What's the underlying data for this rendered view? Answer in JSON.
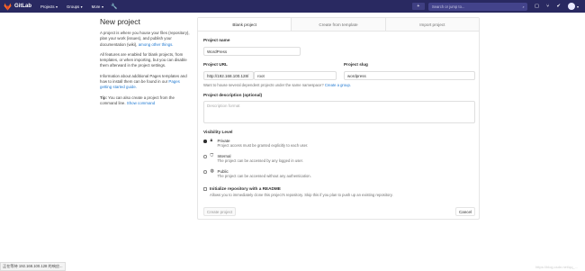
{
  "nav": {
    "brand": "GitLab",
    "projects": "Projects",
    "groups": "Groups",
    "more": "More",
    "search_placeholder": "Search or jump to...",
    "plus": "+"
  },
  "left": {
    "title": "New project",
    "p1": "A project is where you house your files (repository), plan your work (issues), and publish your documentation (wiki),",
    "p1_link": "among other things.",
    "p2": "All features are enabled for blank projects, from templates, or when importing, but you can disable them afterward in the project settings.",
    "p3": "Information about additional Pages templates and how to install them can be found in our",
    "p3_link": "Pages getting started guide.",
    "tip_label": "Tip:",
    "tip_text": "You can also create a project from the command line.",
    "tip_link": "Show command"
  },
  "tabs": [
    "Blank project",
    "Create from template",
    "Import project"
  ],
  "form": {
    "name_label": "Project name",
    "name_value": "WordPress",
    "url_label": "Project URL",
    "url_prefix": "http://192.168.100.128/",
    "url_namespace": "root",
    "slug_label": "Project slug",
    "slug_value": "wordpress",
    "namespace_hint": "Want to house several dependent projects under the same namespace?",
    "namespace_link": "Create a group.",
    "desc_label": "Project description (optional)",
    "desc_placeholder": "Description format",
    "visibility_label": "Visibility Level",
    "visibility": [
      {
        "title": "Private",
        "desc": "Project access must be granted explicitly to each user.",
        "icon": "lock-icon",
        "selected": true
      },
      {
        "title": "Internal",
        "desc": "The project can be accessed by any logged in user.",
        "icon": "shield-icon",
        "selected": false
      },
      {
        "title": "Public",
        "desc": "The project can be accessed without any authentication.",
        "icon": "globe-icon",
        "selected": false
      }
    ],
    "readme_label": "Initialize repository with a README",
    "readme_desc": "Allows you to immediately clone this project’s repository. Skip this if you plan to push up an existing repository.",
    "create_button": "Create project",
    "cancel_button": "Cancel"
  },
  "status_text": "正在等待 192.168.100.128 的响应...",
  "watermark": "https://blog.csdn.net/qq_...",
  "colors": {
    "nav_bg": "#292961",
    "link": "#1f78d1"
  }
}
